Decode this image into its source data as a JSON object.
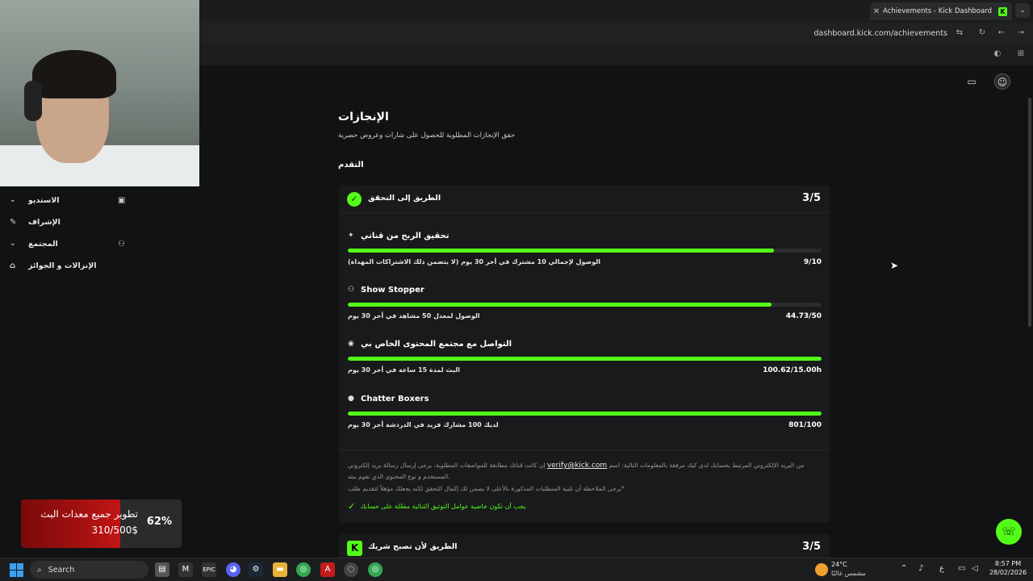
{
  "browser": {
    "tab_title": "Achievements - Kick Dashboard",
    "url": "dashboard.kick.com/achievements"
  },
  "sidebar": {
    "items": [
      {
        "label": "الاستديو",
        "icon": "studio-icon"
      },
      {
        "label": "الإشراف",
        "icon": "wrench-icon"
      },
      {
        "label": "المجتمع",
        "icon": "community-icon"
      },
      {
        "label": "الإنزالات و الجوائز",
        "icon": "gift-icon"
      }
    ]
  },
  "page": {
    "title": "الإنجازات",
    "subtitle": "حقق الإنجازات المطلوبة للحصول على شارات وعروض حصرية",
    "section": "التقدم"
  },
  "verification_card": {
    "title": "الطريق إلى التحقق",
    "count": "3/5",
    "achievements": [
      {
        "name": "تحقيق الربح من قناتي",
        "icon": "sparkle-icon",
        "desc": "الوصول لإجمالي 10 مشترك في أخر 30 يوم (لا يتضمن ذلك الاشتراكات المهداة)",
        "value": "9/10",
        "progress": 0.9
      },
      {
        "name": "Show Stopper",
        "icon": "viewers-icon",
        "desc": "الوصول لمعدل 50 مشاهد في أخر 30 يوم",
        "value": "44.73/50",
        "progress": 0.8946
      },
      {
        "name": "التواصل مع مجتمع المحتوى الخاص بي",
        "icon": "broadcast-icon",
        "desc": "البث لمدة 15 ساعة في أخر 30 يوم",
        "value": "100.62/15.00h",
        "progress": 1.0
      },
      {
        "name": "Chatter Boxers",
        "icon": "chat-icon",
        "desc": "لديك 100 مشارك فريد في الدردشة أخر 30 يوم",
        "value": "801/100",
        "progress": 1.0
      }
    ],
    "note_before": "إن كانت قناتك مطابقة للمواصفات المطلوبة، يرجى إرسال رسالة بريد إلكتروني",
    "email": "verify@kick.com",
    "note_after": "من البريد الإلكتروني المرتبط بحسابك لدى كيك مرفقة بالمعلومات التالية: اسم المستخدم و نوع المحتوى الذي تقوم ببثه.",
    "note2": "يرجى الملاحظة أن تلبية المتطلبات المذكورة بالأعلى لا يضمن لك إكمال التحقق لكنه يجعلك مؤهلاً لتقديم طلب*",
    "requirement": "يجب أن تكون خاصية عوامل التوثيق الثنائية مفعّلة على حسابك"
  },
  "partner_card": {
    "title": "الطريق لأن تصبح شريك",
    "count": "3/5"
  },
  "goal_widget": {
    "title": "تطوير جميع معدات البث",
    "amount": "310/500$",
    "percent": "62%",
    "progress": 0.62,
    "fill_color": "#c01515"
  },
  "taskbar": {
    "search_label": "Search",
    "weather_temp": "24°C",
    "weather_desc": "مشمس غالبًا",
    "lang": "ع",
    "time": "8:57 PM",
    "date": "28/02/2026"
  },
  "colors": {
    "accent": "#53fc18",
    "background": "#111213",
    "card": "#191a1b"
  }
}
